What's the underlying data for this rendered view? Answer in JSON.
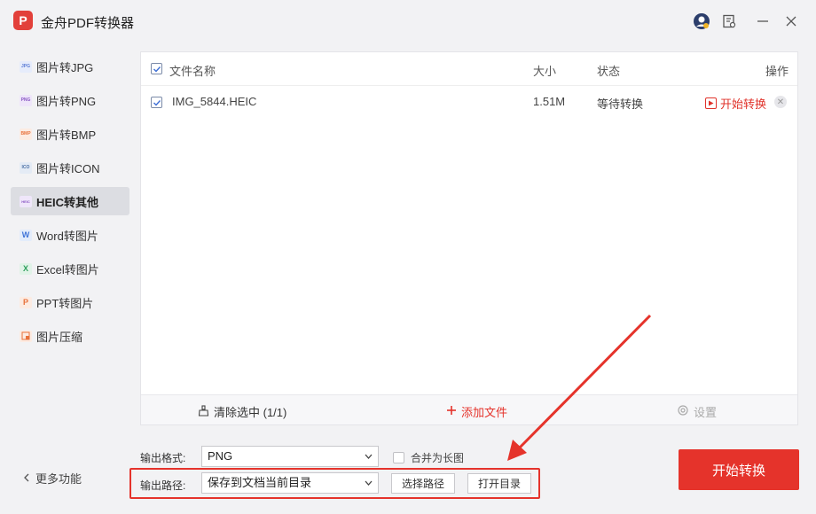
{
  "app": {
    "title": "金舟PDF转换器",
    "logo_letter": "P"
  },
  "sidebar": {
    "items": [
      {
        "label": "图片转JPG",
        "icon": "jpg-icon",
        "icon_text": "JPG",
        "icon_color": "#5b7bd5"
      },
      {
        "label": "图片转PNG",
        "icon": "png-icon",
        "icon_text": "PNG",
        "icon_color": "#8a58c4"
      },
      {
        "label": "图片转BMP",
        "icon": "bmp-icon",
        "icon_text": "BMP",
        "icon_color": "#e8713b"
      },
      {
        "label": "图片转ICON",
        "icon": "ico-icon",
        "icon_text": "ICO",
        "icon_color": "#4a6fa5"
      },
      {
        "label": "HEIC转其他",
        "icon": "heic-icon",
        "icon_text": "HEIC",
        "icon_color": "#8a58c4"
      },
      {
        "label": "Word转图片",
        "icon": "word-icon",
        "icon_text": "W",
        "icon_color": "#3f74d8"
      },
      {
        "label": "Excel转图片",
        "icon": "excel-icon",
        "icon_text": "X",
        "icon_color": "#2e9e5b"
      },
      {
        "label": "PPT转图片",
        "icon": "ppt-icon",
        "icon_text": "P",
        "icon_color": "#e8713b"
      },
      {
        "label": "图片压缩",
        "icon": "compress-icon",
        "icon_text": "",
        "icon_color": "#e8713b"
      }
    ],
    "active_index": 4,
    "more_label": "更多功能"
  },
  "table": {
    "headers": {
      "name": "文件名称",
      "size": "大小",
      "status": "状态",
      "action": "操作"
    },
    "rows": [
      {
        "name": "IMG_5844.HEIC",
        "size": "1.51M",
        "status": "等待转换",
        "action": "开始转换",
        "checked": true
      }
    ]
  },
  "footer": {
    "clear_label": "清除选中 (1/1)",
    "add_label": "添加文件",
    "settings_label": "设置"
  },
  "options": {
    "format_label": "输出格式:",
    "format_value": "PNG",
    "merge_label": "合并为长图",
    "merge_checked": false,
    "path_label": "输出路径:",
    "path_value": "保存到文档当前目录",
    "choose_path_label": "选择路径",
    "open_dir_label": "打开目录"
  },
  "convert_button": "开始转换",
  "colors": {
    "accent": "#e5332b",
    "active_bg": "#dcdde2"
  }
}
